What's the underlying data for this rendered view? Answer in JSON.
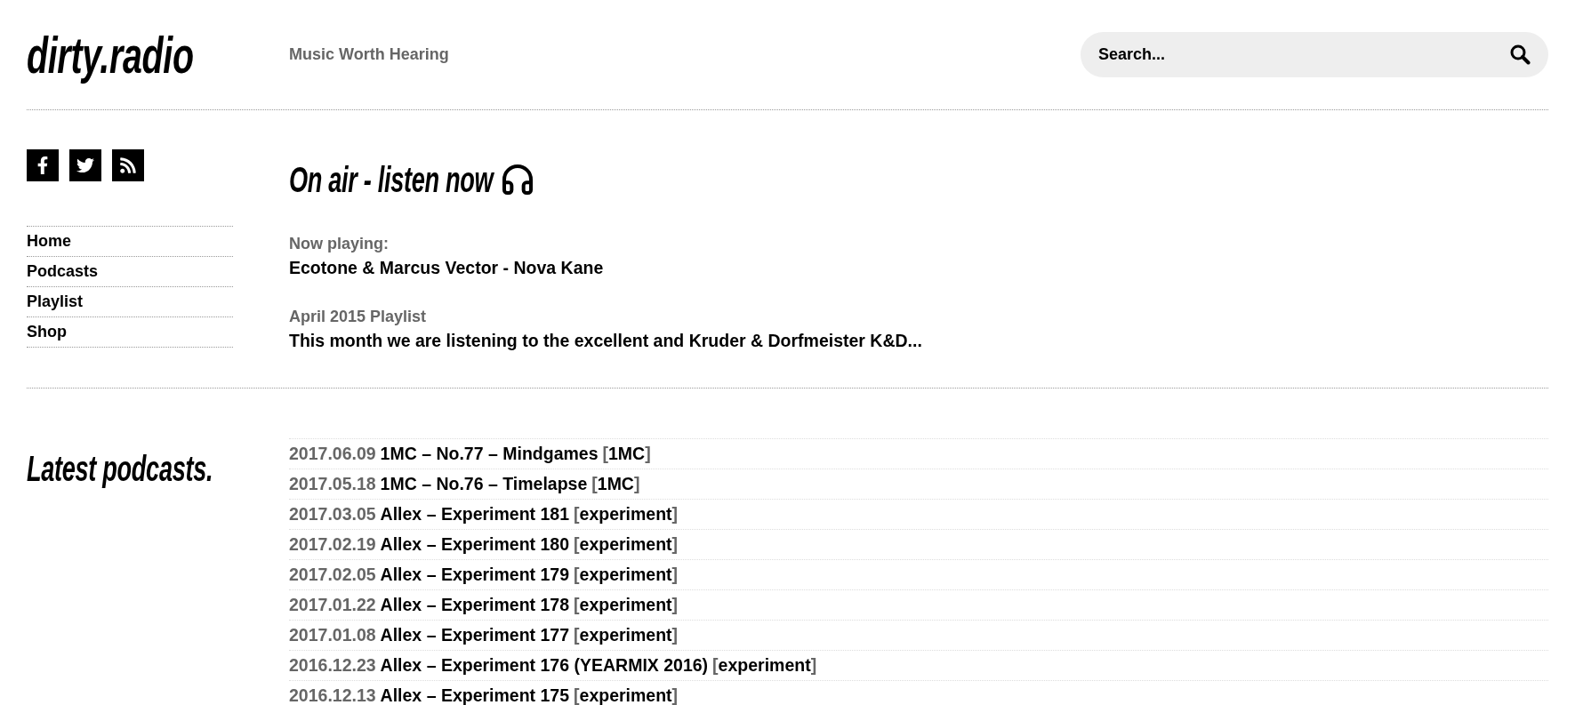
{
  "header": {
    "logo": "dirty.radio",
    "tagline": "Music Worth Hearing",
    "search": {
      "placeholder": "Search..."
    }
  },
  "nav": [
    {
      "label": "Home"
    },
    {
      "label": "Podcasts"
    },
    {
      "label": "Playlist"
    },
    {
      "label": "Shop"
    }
  ],
  "on_air": {
    "title": "On air - listen now",
    "now_playing_label": "Now playing:",
    "now_playing": "Ecotone & Marcus Vector - Nova Kane",
    "playlist_title": "April 2015 Playlist",
    "playlist_excerpt": "This month we are listening to the excellent and Kruder & Dorfmeister K&D..."
  },
  "latest": {
    "title": "Latest podcasts.",
    "items": [
      {
        "date": "2017.06.09",
        "title": "1MC – No.77 – Mindgames",
        "tag": "[1MC]"
      },
      {
        "date": "2017.05.18",
        "title": "1MC – No.76 – Timelapse",
        "tag": "[1MC]"
      },
      {
        "date": "2017.03.05",
        "title": "Allex – Experiment 181",
        "tag": "[experiment]"
      },
      {
        "date": "2017.02.19",
        "title": "Allex – Experiment 180",
        "tag": "[experiment]"
      },
      {
        "date": "2017.02.05",
        "title": "Allex – Experiment 179",
        "tag": "[experiment]"
      },
      {
        "date": "2017.01.22",
        "title": "Allex – Experiment 178",
        "tag": "[experiment]"
      },
      {
        "date": "2017.01.08",
        "title": "Allex – Experiment 177",
        "tag": "[experiment]"
      },
      {
        "date": "2016.12.23",
        "title": "Allex – Experiment 176 (YEARMIX 2016)",
        "tag": "[experiment]"
      },
      {
        "date": "2016.12.13",
        "title": "Allex – Experiment 175",
        "tag": "[experiment]"
      }
    ]
  }
}
